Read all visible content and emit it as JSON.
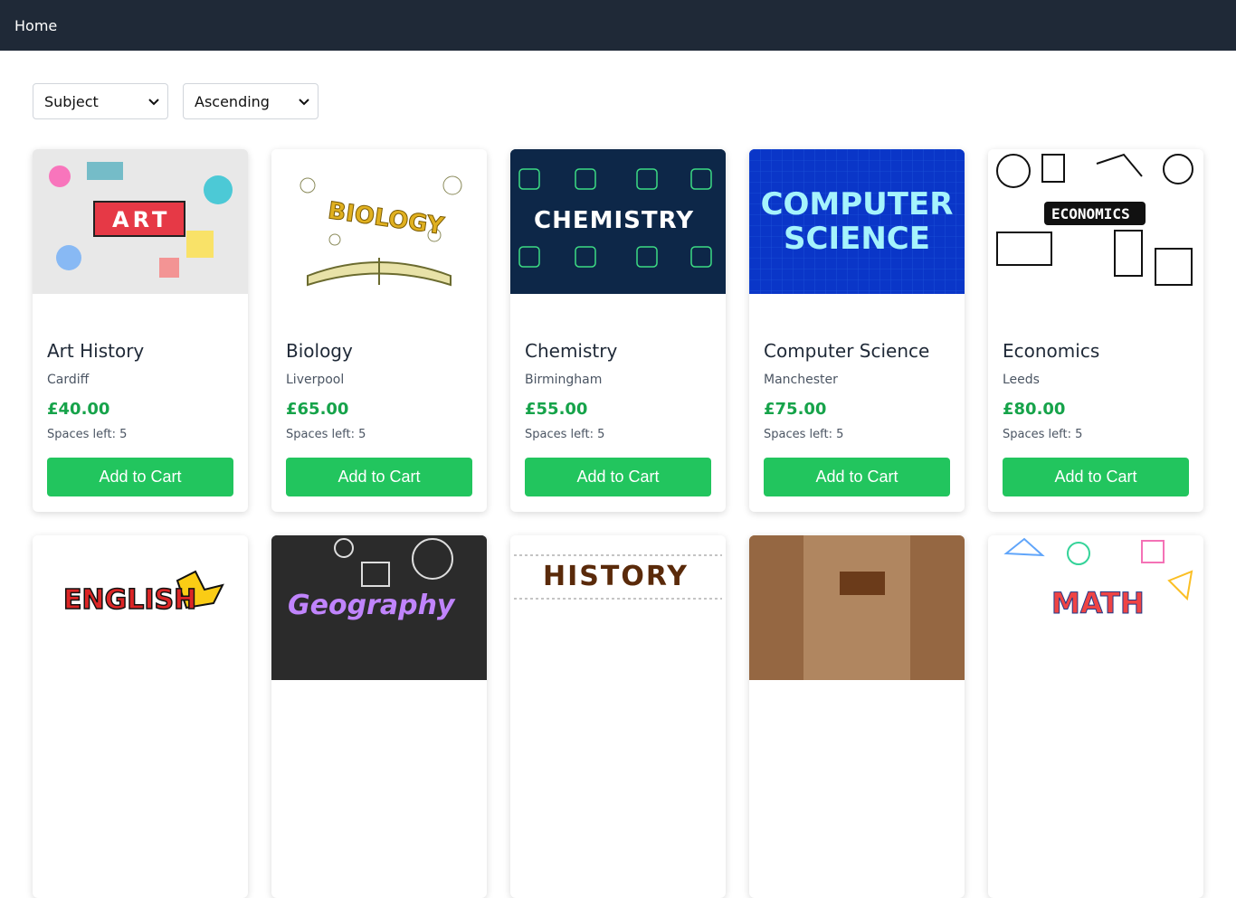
{
  "nav": {
    "home_label": "Home"
  },
  "filters": {
    "sort_by": "Subject",
    "order": "Ascending"
  },
  "courses": [
    {
      "title": "Art History",
      "location": "Cardiff",
      "price": "£40.00",
      "spaces": "Spaces left: 5",
      "button": "Add to Cart",
      "image_text": "ART"
    },
    {
      "title": "Biology",
      "location": "Liverpool",
      "price": "£65.00",
      "spaces": "Spaces left: 5",
      "button": "Add to Cart",
      "image_text": "BIOLOGY"
    },
    {
      "title": "Chemistry",
      "location": "Birmingham",
      "price": "£55.00",
      "spaces": "Spaces left: 5",
      "button": "Add to Cart",
      "image_text": "CHEMISTRY"
    },
    {
      "title": "Computer Science",
      "location": "Manchester",
      "price": "£75.00",
      "spaces": "Spaces left: 5",
      "button": "Add to Cart",
      "image_text": "COMPUTER SCIENCE"
    },
    {
      "title": "Economics",
      "location": "Leeds",
      "price": "£80.00",
      "spaces": "Spaces left: 5",
      "button": "Add to Cart",
      "image_text": "ECONOMICS"
    }
  ],
  "second_row_images": [
    {
      "image_text": "ENGLISH"
    },
    {
      "image_text": "Geography"
    },
    {
      "image_text": "HISTORY"
    },
    {
      "image_text": ""
    },
    {
      "image_text": "MATH"
    }
  ],
  "colors": {
    "nav_bg": "#1f2937",
    "accent_green": "#22c55e",
    "price_green": "#16a34a"
  }
}
